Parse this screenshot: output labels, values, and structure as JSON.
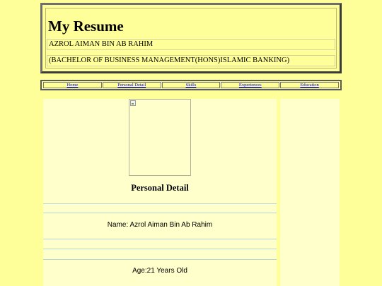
{
  "header": {
    "title": "My Resume",
    "name": "AZROL AIMAN BIN AB RAHIM",
    "degree": "(BACHELOR OF BUSINESS MANAGEMENT(HONS)ISLAMIC BANKING)"
  },
  "nav": {
    "items": [
      {
        "label": "Home"
      },
      {
        "label": "Personal Detail"
      },
      {
        "label": "Skills"
      },
      {
        "label": "Experiences"
      },
      {
        "label": "Education"
      }
    ]
  },
  "main": {
    "photo": {
      "icon": "broken-image-icon"
    },
    "section_title": "Personal Detail",
    "details": {
      "name": "Name: Azrol Aiman Bin Ab Rahim",
      "age": "Age:21 Years Old"
    }
  },
  "colors": {
    "page_background": "#ffff99",
    "panel_background": "#ffffcc",
    "link": "#0000ee",
    "divider": "#b7d6d6"
  }
}
